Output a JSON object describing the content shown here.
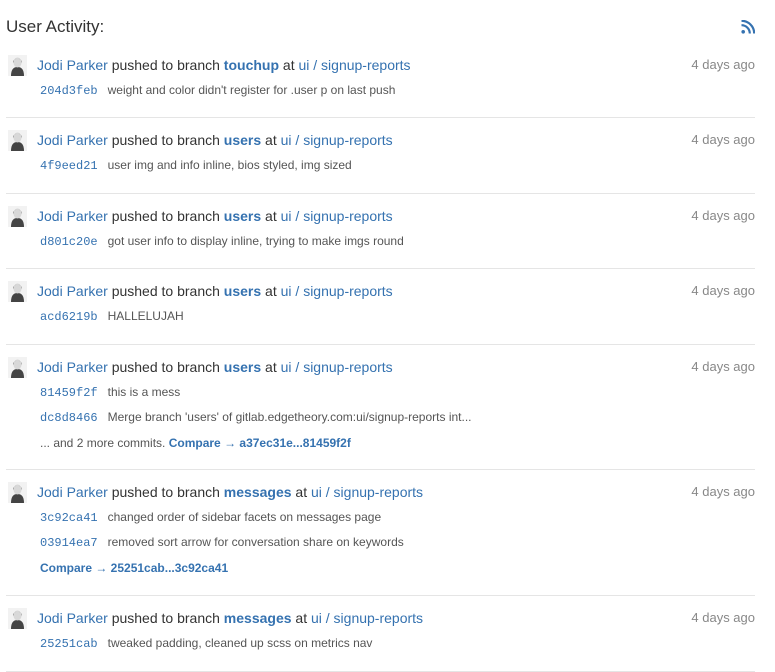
{
  "header": {
    "title": "User Activity:",
    "rss_icon": "rss-icon"
  },
  "events": [
    {
      "author": "Jodi Parker",
      "action": "pushed to branch",
      "branch": "touchup",
      "at": "at",
      "repo": "ui / signup-reports",
      "time": "4 days ago",
      "commits": [
        {
          "sha": "204d3feb",
          "message": "weight and color didn't register for .user p on last push"
        }
      ]
    },
    {
      "author": "Jodi Parker",
      "action": "pushed to branch",
      "branch": "users",
      "at": "at",
      "repo": "ui / signup-reports",
      "time": "4 days ago",
      "commits": [
        {
          "sha": "4f9eed21",
          "message": "user img and info inline, bios styled, img sized"
        }
      ]
    },
    {
      "author": "Jodi Parker",
      "action": "pushed to branch",
      "branch": "users",
      "at": "at",
      "repo": "ui / signup-reports",
      "time": "4 days ago",
      "commits": [
        {
          "sha": "d801c20e",
          "message": "got user info to display inline, trying to make imgs round"
        }
      ]
    },
    {
      "author": "Jodi Parker",
      "action": "pushed to branch",
      "branch": "users",
      "at": "at",
      "repo": "ui / signup-reports",
      "time": "4 days ago",
      "commits": [
        {
          "sha": "acd6219b",
          "message": "HALLELUJAH"
        }
      ]
    },
    {
      "author": "Jodi Parker",
      "action": "pushed to branch",
      "branch": "users",
      "at": "at",
      "repo": "ui / signup-reports",
      "time": "4 days ago",
      "commits": [
        {
          "sha": "81459f2f",
          "message": "this is a mess"
        },
        {
          "sha": "dc8d8466",
          "message": "Merge branch 'users' of gitlab.edgetheory.com:ui/signup-reports int..."
        }
      ],
      "more_text": "... and 2 more commits.",
      "compare": "Compare → a37ec31e...81459f2f"
    },
    {
      "author": "Jodi Parker",
      "action": "pushed to branch",
      "branch": "messages",
      "at": "at",
      "repo": "ui / signup-reports",
      "time": "4 days ago",
      "commits": [
        {
          "sha": "3c92ca41",
          "message": "changed order of sidebar facets on messages page"
        },
        {
          "sha": "03914ea7",
          "message": "removed sort arrow for conversation share on keywords"
        }
      ],
      "more_text": "",
      "compare": "Compare → 25251cab...3c92ca41"
    },
    {
      "author": "Jodi Parker",
      "action": "pushed to branch",
      "branch": "messages",
      "at": "at",
      "repo": "ui / signup-reports",
      "time": "4 days ago",
      "commits": [
        {
          "sha": "25251cab",
          "message": "tweaked padding, cleaned up scss on metrics nav"
        }
      ]
    }
  ],
  "colors": {
    "link": "#3572b0",
    "rss": "#3572b0",
    "muted": "#888888",
    "divider": "#e5e5e5"
  }
}
